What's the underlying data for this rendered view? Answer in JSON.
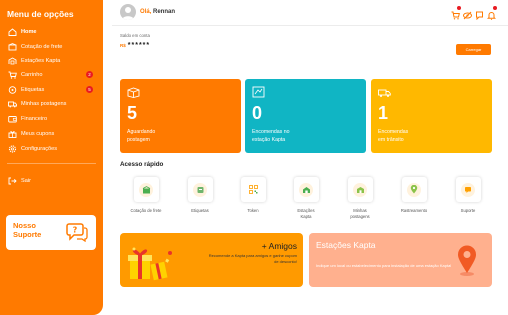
{
  "sidebar": {
    "title": "Menu de opções",
    "items": [
      {
        "label": "Home",
        "icon": "home-icon"
      },
      {
        "label": "Cotação de frete",
        "icon": "box-icon"
      },
      {
        "label": "Estações Kapta",
        "icon": "station-icon"
      },
      {
        "label": "Carrinho",
        "icon": "cart-icon",
        "badge": "2"
      },
      {
        "label": "Etiquetas",
        "icon": "tag-icon",
        "badge": "5"
      },
      {
        "label": "Minhas postagens",
        "icon": "truck-icon"
      },
      {
        "label": "Financeiro",
        "icon": "wallet-icon"
      },
      {
        "label": "Meus cupons",
        "icon": "gift-icon"
      },
      {
        "label": "Configurações",
        "icon": "gear-icon"
      }
    ],
    "logout_label": "Sair",
    "support": {
      "line1": "Nosso",
      "line2": "Suporte"
    }
  },
  "header": {
    "greeting": "Olá,",
    "username": "Rennan"
  },
  "balance": {
    "label": "Saldo em conta",
    "currency": "R$",
    "value": "******",
    "button_label": "Carregar"
  },
  "stats": [
    {
      "value": "5",
      "label_line1": "Aguardando",
      "label_line2": "postagem",
      "color": "#ff7a00"
    },
    {
      "value": "0",
      "label_line1": "Encomendas no",
      "label_line2": "estação Kapta",
      "color": "#10b5c4"
    },
    {
      "value": "1",
      "label_line1": "Encomendas",
      "label_line2": "em trânsito",
      "color": "#ffb800"
    }
  ],
  "quick_access": {
    "title": "Acesso rápido",
    "items": [
      {
        "label": "Cotação de frete"
      },
      {
        "label": "Etiquetas"
      },
      {
        "label": "Token"
      },
      {
        "label": "Estações Kapta"
      },
      {
        "label": "Minhas postagens"
      },
      {
        "label": "Rastreamento"
      },
      {
        "label": "Suporte"
      }
    ]
  },
  "banners": {
    "amigos": {
      "title": "+ Amigos",
      "description": "Recomende a Kapta para amigos e ganhe cupom de desconto!"
    },
    "estacoes": {
      "title": "Estações Kapta",
      "description": "Indique um local ou estabelecimento para instalação de uma estação Kapta!"
    }
  },
  "colors": {
    "brand": "#ff7a00",
    "teal": "#10b5c4",
    "yellow": "#ffb800",
    "badge": "#e81b22"
  }
}
